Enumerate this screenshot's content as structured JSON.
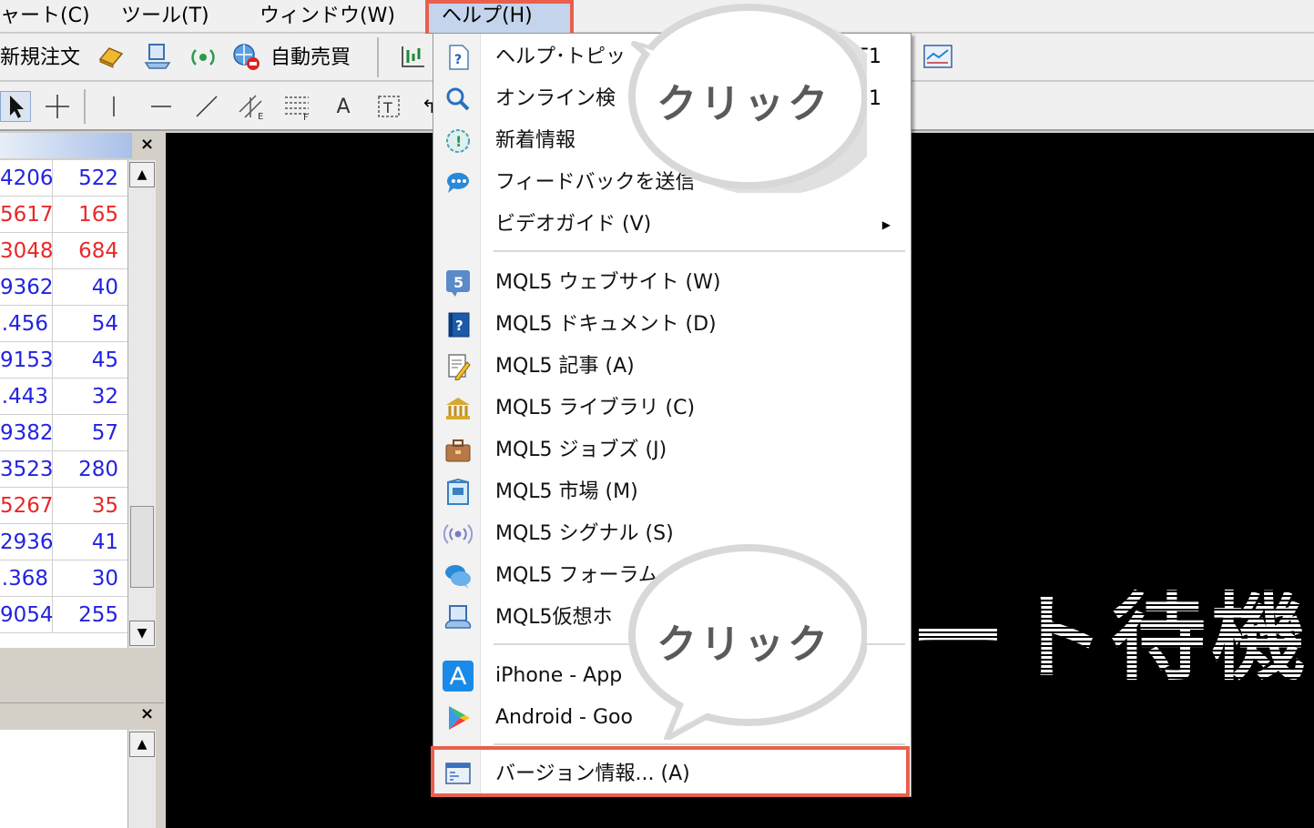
{
  "menubar": {
    "items": [
      "ャート(C)",
      "ツール(T)",
      "ウィンドウ(W)",
      "ヘルプ(H)"
    ]
  },
  "toolbar": {
    "new_order": "新規注文",
    "auto_trade": "自動売買"
  },
  "market_watch": {
    "rows": [
      {
        "bid": "4206",
        "spread": "522",
        "color": "blue"
      },
      {
        "bid": "5617",
        "spread": "165",
        "color": "red"
      },
      {
        "bid": "3048",
        "spread": "684",
        "color": "red"
      },
      {
        "bid": "9362",
        "spread": "40",
        "color": "blue"
      },
      {
        "bid": ".456",
        "spread": "54",
        "color": "blue"
      },
      {
        "bid": "9153",
        "spread": "45",
        "color": "blue"
      },
      {
        "bid": ".443",
        "spread": "32",
        "color": "blue"
      },
      {
        "bid": "9382",
        "spread": "57",
        "color": "blue"
      },
      {
        "bid": "3523",
        "spread": "280",
        "color": "blue"
      },
      {
        "bid": "5267",
        "spread": "35",
        "color": "red"
      },
      {
        "bid": "2936",
        "spread": "41",
        "color": "blue"
      },
      {
        "bid": ".368",
        "spread": "30",
        "color": "blue"
      },
      {
        "bid": "9054",
        "spread": "255",
        "color": "blue"
      }
    ]
  },
  "chart": {
    "waiting_text": "ート待機"
  },
  "help_menu": {
    "items": [
      {
        "label": "ヘルプ･トピッ",
        "shortcut": "F1",
        "icon": "help-topics-icon"
      },
      {
        "label": "オンライン検",
        "shortcut": "1",
        "icon": "search-icon"
      },
      {
        "label": "新着情報",
        "icon": "news-icon"
      },
      {
        "label": "フィードバックを送信",
        "icon": "feedback-icon"
      },
      {
        "label": "ビデオガイド (V)",
        "icon": "",
        "submenu": true
      },
      {
        "label": "MQL5 ウェブサイト (W)",
        "icon": "mql5-website-icon"
      },
      {
        "label": "MQL5 ドキュメント (D)",
        "icon": "documentation-icon"
      },
      {
        "label": "MQL5 記事 (A)",
        "icon": "articles-icon"
      },
      {
        "label": "MQL5 ライブラリ (C)",
        "icon": "library-icon"
      },
      {
        "label": "MQL5 ジョブズ (J)",
        "icon": "jobs-icon"
      },
      {
        "label": "MQL5 市場 (M)",
        "icon": "market-icon"
      },
      {
        "label": "MQL5 シグナル (S)",
        "icon": "signals-icon"
      },
      {
        "label": "MQL5 フォーラム",
        "icon": "forum-icon"
      },
      {
        "label": "MQL5仮想ホ",
        "icon": "vps-icon"
      },
      {
        "label": "iPhone - App",
        "icon": "app-store-icon"
      },
      {
        "label": "Android - Goo",
        "icon": "google-play-icon"
      },
      {
        "label": "バージョン情報... (A)",
        "icon": "about-icon"
      }
    ]
  },
  "callouts": {
    "top": "クリック",
    "bottom": "クリック"
  },
  "colors": {
    "highlight": "#e8604d",
    "bid_blue": "#2323e0",
    "bid_red": "#e82828"
  }
}
